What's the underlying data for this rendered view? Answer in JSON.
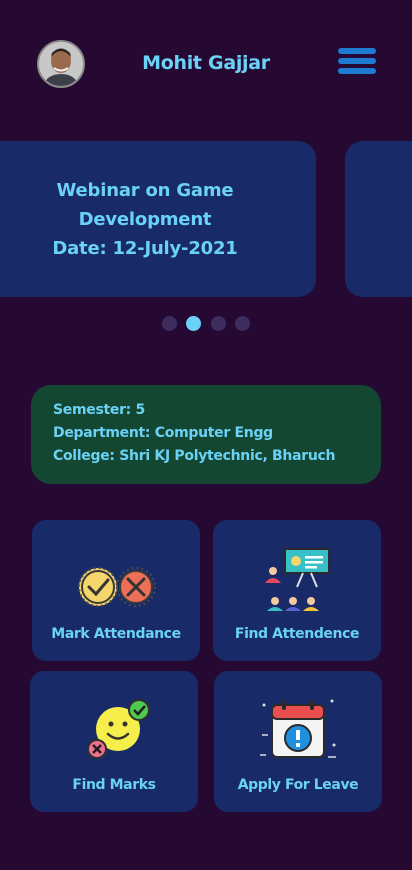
{
  "header": {
    "user_name": "Mohit Gajjar",
    "avatar_icon": "profile-photo",
    "menu_icon": "hamburger-menu-icon"
  },
  "carousel": {
    "slides": [
      {
        "lines": [
          "Webinar on Game",
          "Development",
          "Date: 12-July-2021"
        ]
      }
    ],
    "page_count": 4,
    "active_index": 1
  },
  "info": {
    "semester": "Semester: 5",
    "department": "Department: Computer Engg",
    "college": "College: Shri KJ Polytechnic, Bharuch"
  },
  "actions": [
    {
      "label": "Mark Attendance",
      "icon": "check-cross-icon"
    },
    {
      "label": "Find Attendence",
      "icon": "classroom-icon"
    },
    {
      "label": "Find Marks",
      "icon": "smiley-marks-icon"
    },
    {
      "label": "Apply For Leave",
      "icon": "calendar-alert-icon"
    }
  ],
  "colors": {
    "background": "#260933",
    "accent_text": "#6ad2f6",
    "card": "#182b68",
    "info_card": "#144731",
    "menu": "#1f7bd1"
  }
}
